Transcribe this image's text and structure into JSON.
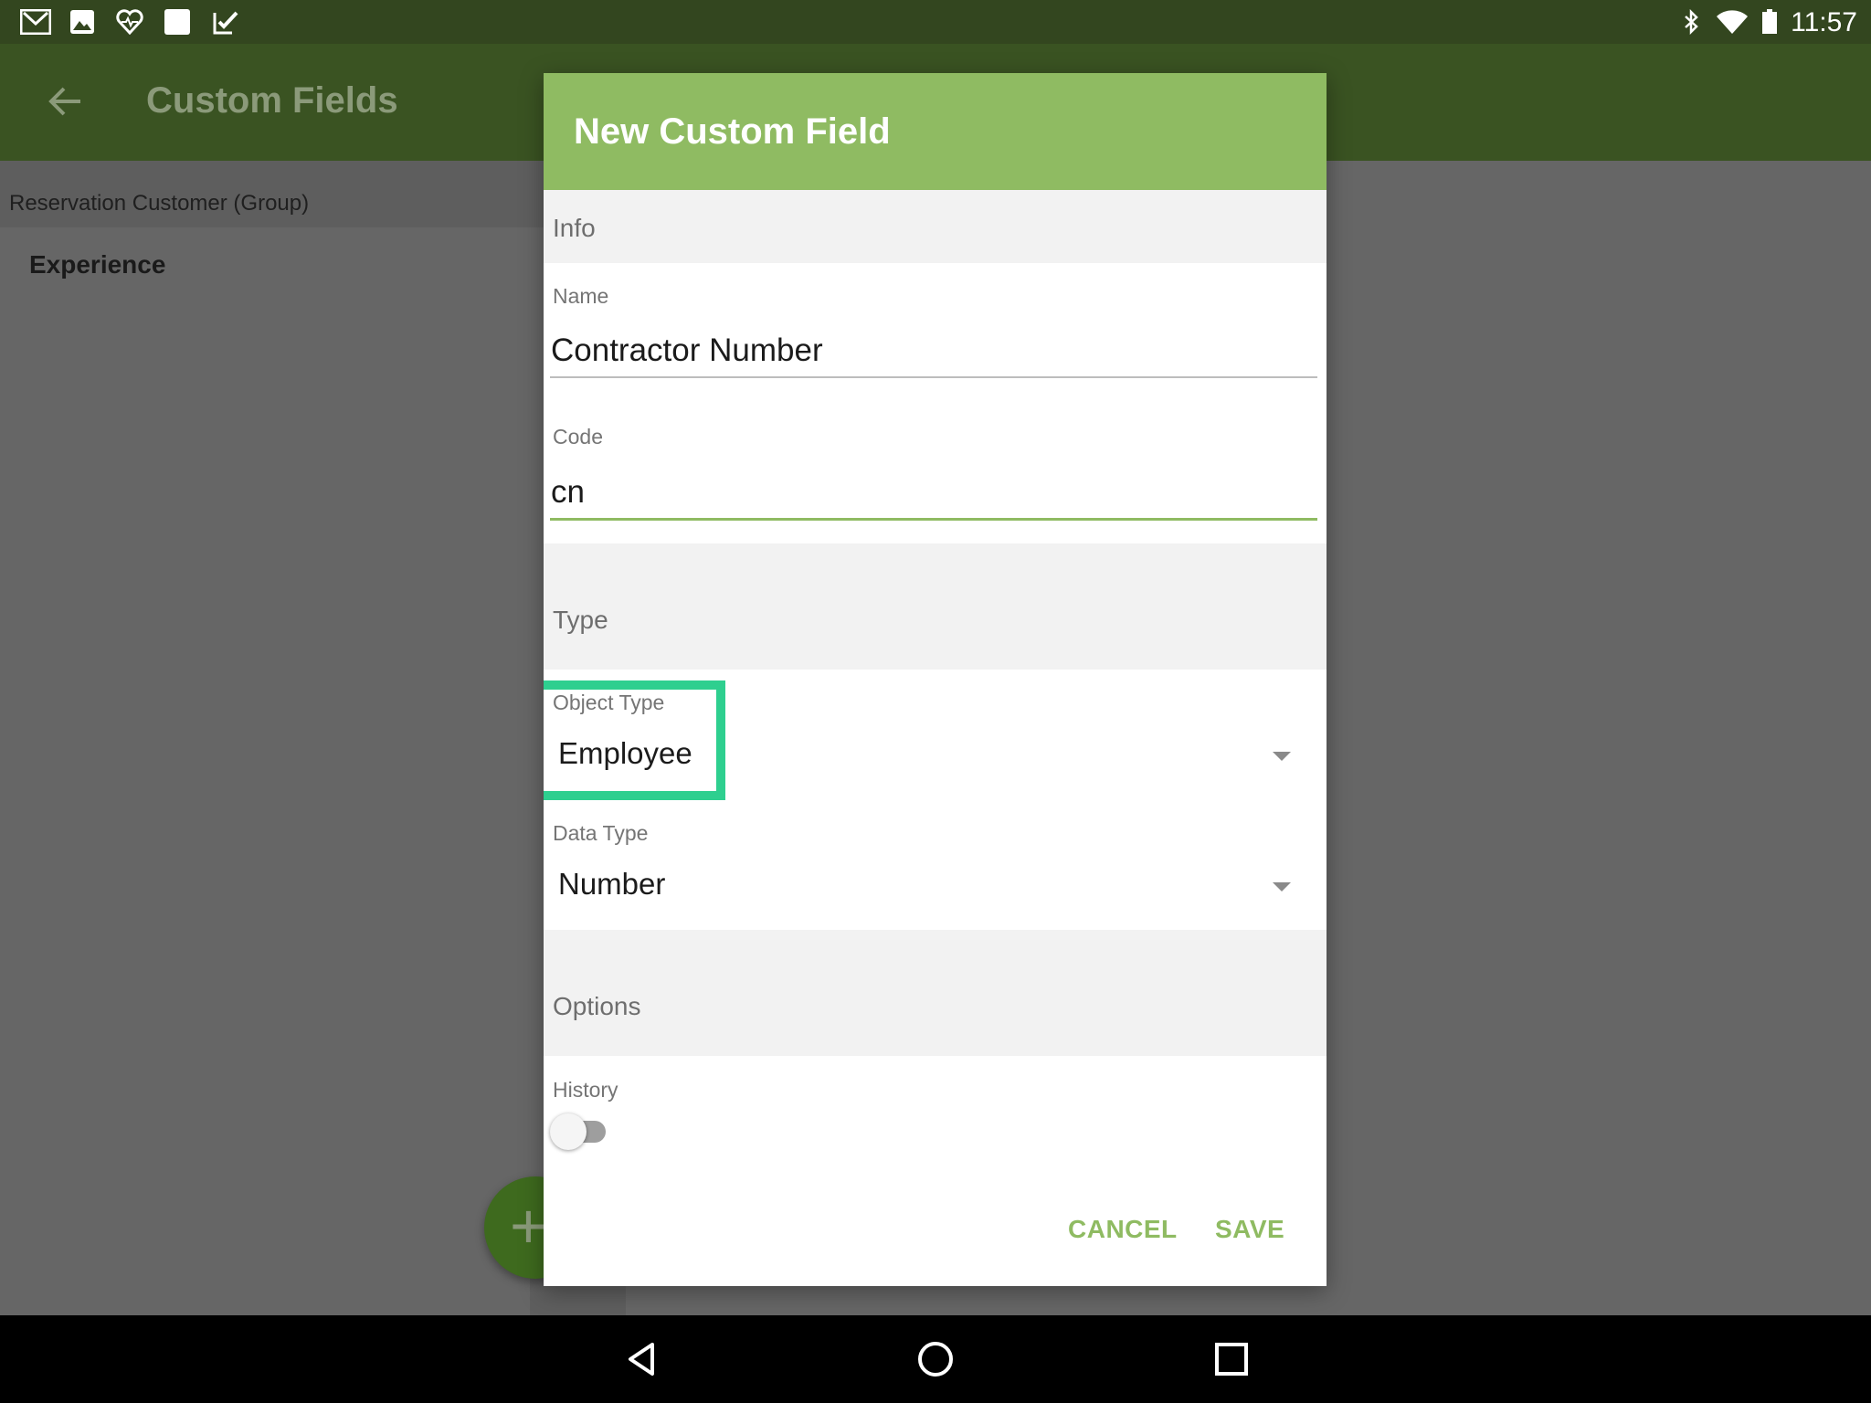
{
  "status_bar": {
    "time": "11:57",
    "left_icons": [
      "gmail-icon",
      "photos-icon",
      "health-icon",
      "square-icon",
      "tasks-icon"
    ],
    "right_icons": [
      "bluetooth-icon",
      "wifi-icon",
      "battery-icon"
    ]
  },
  "app_bar": {
    "title": "Custom Fields",
    "back_icon": "arrow-left-icon"
  },
  "background_list": {
    "group_header": "Reservation Customer (Group)",
    "items": [
      {
        "label": "Experience"
      }
    ],
    "fab_icon": "plus-icon"
  },
  "dialog": {
    "title": "New Custom Field",
    "sections": {
      "info": "Info",
      "type": "Type",
      "options": "Options"
    },
    "fields": {
      "name": {
        "label": "Name",
        "value": "Contractor Number"
      },
      "code": {
        "label": "Code",
        "value": "cn"
      },
      "object_type": {
        "label": "Object Type",
        "value": "Employee"
      },
      "data_type": {
        "label": "Data Type",
        "value": "Number"
      },
      "history": {
        "label": "History",
        "enabled": false
      }
    },
    "buttons": {
      "cancel": "CANCEL",
      "save": "SAVE"
    },
    "colors": {
      "accent": "#8fbb62",
      "highlight": "#2ecf8f",
      "primary_dark": "#33461f"
    }
  },
  "nav_bar": {
    "icons": [
      "back-triangle-icon",
      "home-circle-icon",
      "recents-square-icon"
    ]
  }
}
